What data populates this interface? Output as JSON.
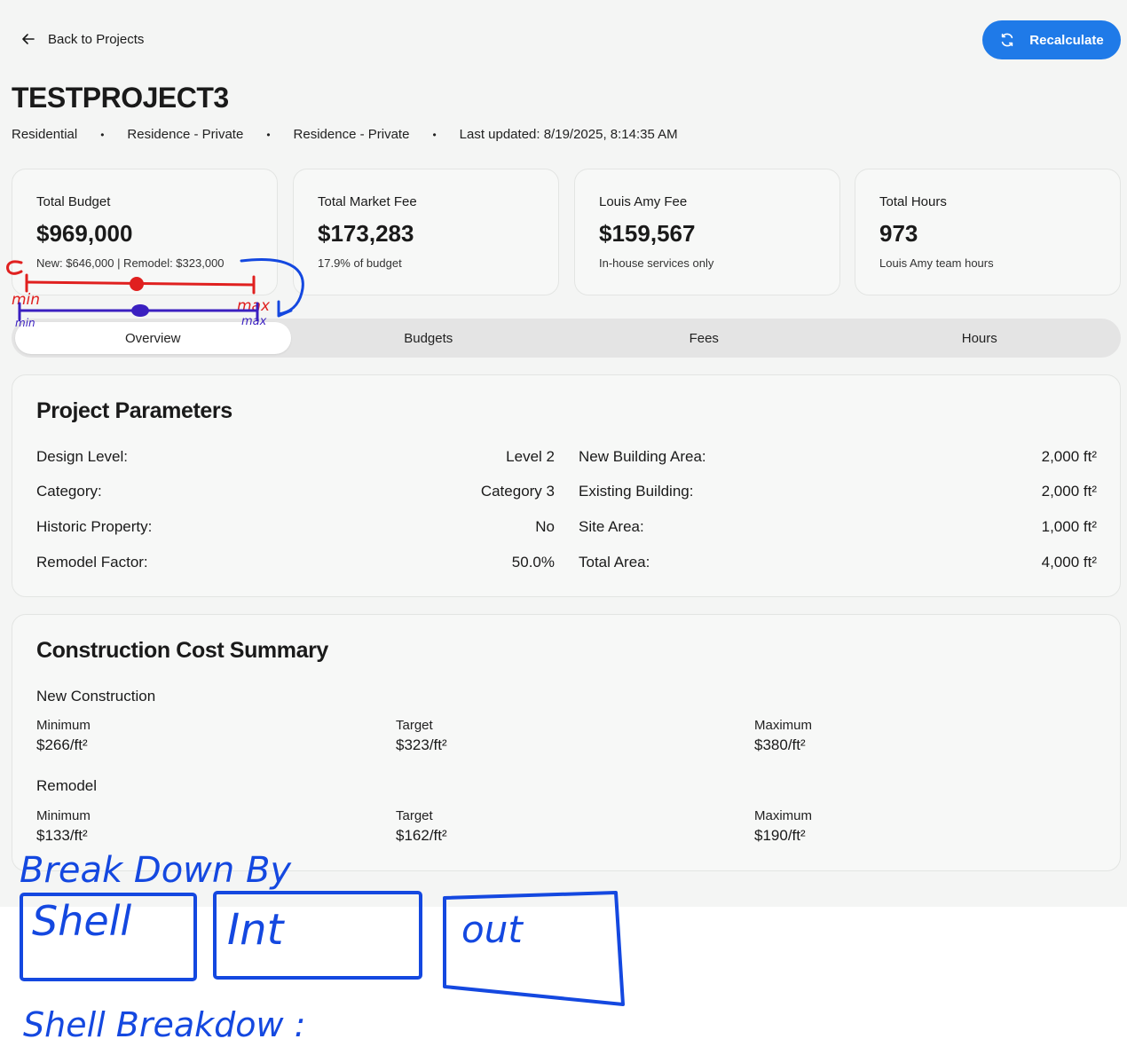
{
  "header": {
    "back_label": "Back to Projects",
    "recalculate_label": "Recalculate",
    "accent_color": "#1f7ae8"
  },
  "project": {
    "title": "TESTPROJECT3",
    "meta": [
      "Residential",
      "Residence - Private",
      "Residence - Private",
      "Last updated: 8/19/2025, 8:14:35 AM"
    ]
  },
  "stats": [
    {
      "label": "Total Budget",
      "value": "$969,000",
      "sub": "New: $646,000 | Remodel: $323,000"
    },
    {
      "label": "Total Market Fee",
      "value": "$173,283",
      "sub": "17.9% of budget"
    },
    {
      "label": "Louis Amy Fee",
      "value": "$159,567",
      "sub": "In-house services only"
    },
    {
      "label": "Total Hours",
      "value": "973",
      "sub": "Louis Amy team hours"
    }
  ],
  "tabs": [
    {
      "label": "Overview",
      "active": true
    },
    {
      "label": "Budgets",
      "active": false
    },
    {
      "label": "Fees",
      "active": false
    },
    {
      "label": "Hours",
      "active": false
    }
  ],
  "parameters": {
    "title": "Project Parameters",
    "left": [
      {
        "label": "Design Level:",
        "value": "Level 2"
      },
      {
        "label": "Category:",
        "value": "Category 3"
      },
      {
        "label": "Historic Property:",
        "value": "No"
      },
      {
        "label": "Remodel Factor:",
        "value": "50.0%"
      }
    ],
    "right": [
      {
        "label": "New Building Area:",
        "value": "2,000 ft²"
      },
      {
        "label": "Existing Building:",
        "value": "2,000 ft²"
      },
      {
        "label": "Site Area:",
        "value": "1,000 ft²"
      },
      {
        "label": "Total Area:",
        "value": "4,000 ft²"
      }
    ]
  },
  "cost_summary": {
    "title": "Construction Cost Summary",
    "groups": [
      {
        "name": "New Construction",
        "cells": [
          {
            "label": "Minimum",
            "value": "$266/ft²"
          },
          {
            "label": "Target",
            "value": "$323/ft²"
          },
          {
            "label": "Maximum",
            "value": "$380/ft²"
          }
        ]
      },
      {
        "name": "Remodel",
        "cells": [
          {
            "label": "Minimum",
            "value": "$133/ft²"
          },
          {
            "label": "Target",
            "value": "$162/ft²"
          },
          {
            "label": "Maximum",
            "value": "$190/ft²"
          }
        ]
      }
    ]
  },
  "annotations": {
    "red_min": "min",
    "red_max": "max",
    "purple_min": "min",
    "purple_max": "max",
    "breakdown_title": "Break Down By",
    "box_shell": "Shell",
    "box_int": "Int",
    "box_out": "out",
    "shell_breakdown": "Shell Breakdow :",
    "red_color": "#e0201f",
    "purple_color": "#3a1fc0",
    "blue_color": "#1448e0"
  }
}
